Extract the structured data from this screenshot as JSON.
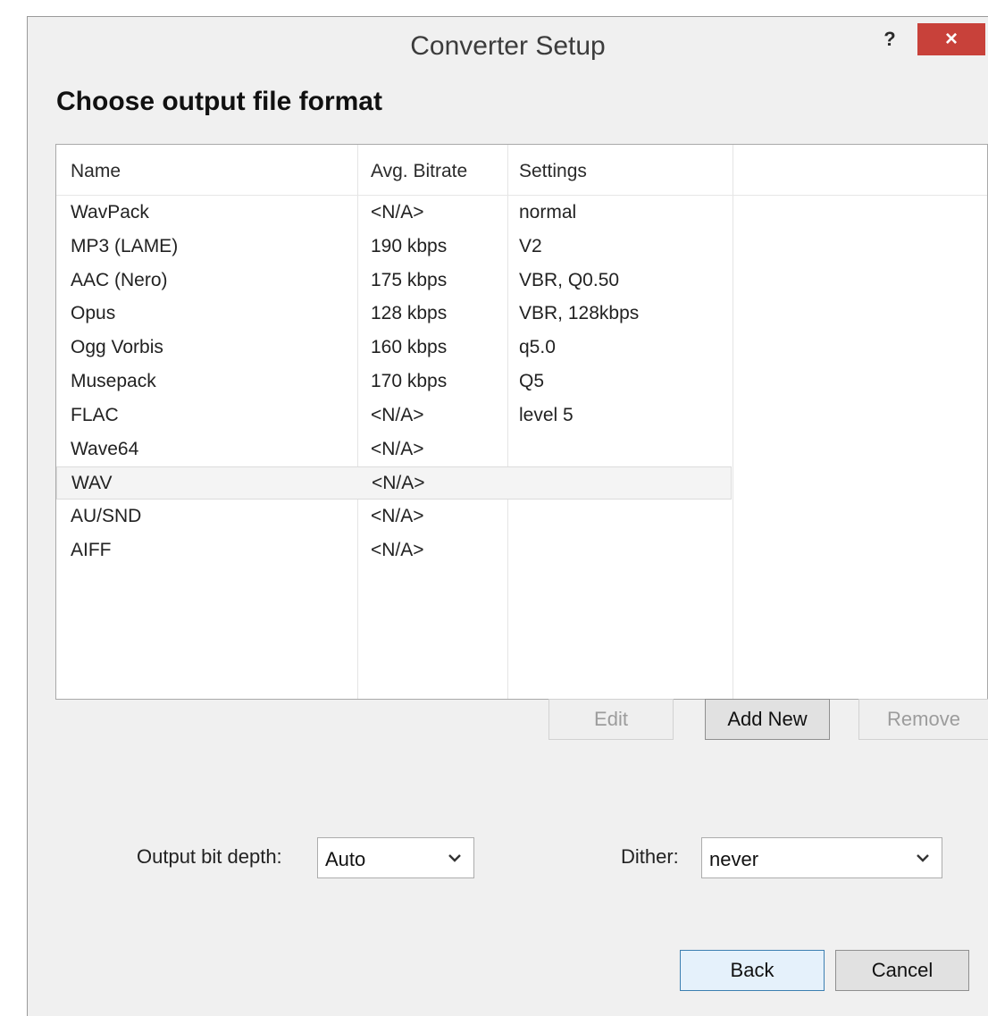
{
  "window": {
    "title": "Converter Setup",
    "help_label": "?",
    "close_label": "×"
  },
  "heading": "Choose output file format",
  "formats": {
    "columns": [
      "Name",
      "Avg. Bitrate",
      "Settings"
    ],
    "rows": [
      {
        "name": "WavPack",
        "bitrate": "<N/A>",
        "settings": "normal"
      },
      {
        "name": "MP3 (LAME)",
        "bitrate": "190 kbps",
        "settings": "V2"
      },
      {
        "name": "AAC (Nero)",
        "bitrate": "175 kbps",
        "settings": "VBR, Q0.50"
      },
      {
        "name": "Opus",
        "bitrate": "128 kbps",
        "settings": "VBR, 128kbps"
      },
      {
        "name": "Ogg Vorbis",
        "bitrate": "160 kbps",
        "settings": "q5.0"
      },
      {
        "name": "Musepack",
        "bitrate": "170 kbps",
        "settings": "Q5"
      },
      {
        "name": "FLAC",
        "bitrate": "<N/A>",
        "settings": "level 5"
      },
      {
        "name": "Wave64",
        "bitrate": "<N/A>",
        "settings": ""
      },
      {
        "name": "WAV",
        "bitrate": "<N/A>",
        "settings": ""
      },
      {
        "name": "AU/SND",
        "bitrate": "<N/A>",
        "settings": ""
      },
      {
        "name": "AIFF",
        "bitrate": "<N/A>",
        "settings": ""
      }
    ],
    "selected_row": "WAV"
  },
  "list_buttons": {
    "edit": "Edit",
    "add_new": "Add New",
    "remove": "Remove"
  },
  "output_bit_depth": {
    "label": "Output bit depth:",
    "value": "Auto"
  },
  "dither": {
    "label": "Dither:",
    "value": "never"
  },
  "footer": {
    "back": "Back",
    "cancel": "Cancel"
  },
  "colors": {
    "close_button": "#c8413a",
    "default_button_border": "#3c7fb1"
  }
}
